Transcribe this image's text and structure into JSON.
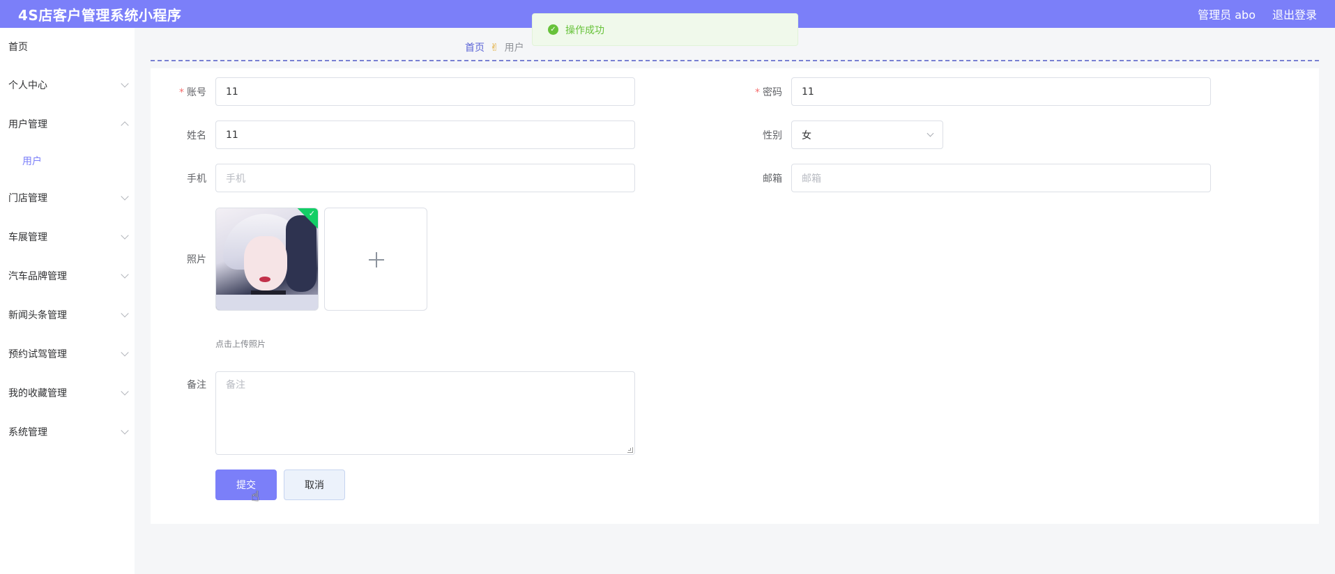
{
  "header": {
    "app_title": "4S店客户管理系统小程序",
    "user_label": "管理员 abo",
    "logout_label": "退出登录"
  },
  "sidebar": {
    "items": [
      {
        "label": "首页"
      },
      {
        "label": "个人中心"
      },
      {
        "label": "用户管理",
        "expanded": true,
        "children": [
          {
            "label": "用户",
            "active": true
          }
        ]
      },
      {
        "label": "门店管理"
      },
      {
        "label": "车展管理"
      },
      {
        "label": "汽车品牌管理"
      },
      {
        "label": "新闻头条管理"
      },
      {
        "label": "预约试驾管理"
      },
      {
        "label": "我的收藏管理"
      },
      {
        "label": "系统管理"
      }
    ]
  },
  "breadcrumb": {
    "home": "首页",
    "separator_icon": "hand-icon",
    "current": "用户"
  },
  "toast": {
    "message": "操作成功",
    "icon": "success-check-icon"
  },
  "form": {
    "account": {
      "label": "账号",
      "value": "11",
      "required": true
    },
    "password": {
      "label": "密码",
      "value": "11",
      "required": true
    },
    "name": {
      "label": "姓名",
      "value": "11"
    },
    "gender": {
      "label": "性别",
      "value": "女"
    },
    "phone": {
      "label": "手机",
      "value": "",
      "placeholder": "手机"
    },
    "email": {
      "label": "邮箱",
      "value": "",
      "placeholder": "邮箱"
    },
    "photo": {
      "label": "照片",
      "tip": "点击上传照片"
    },
    "remark": {
      "label": "备注",
      "value": "",
      "placeholder": "备注"
    },
    "submit_label": "提交",
    "cancel_label": "取消"
  },
  "colors": {
    "accent": "#7b7ff9",
    "success": "#67c23a",
    "required": "#f56c6c"
  }
}
